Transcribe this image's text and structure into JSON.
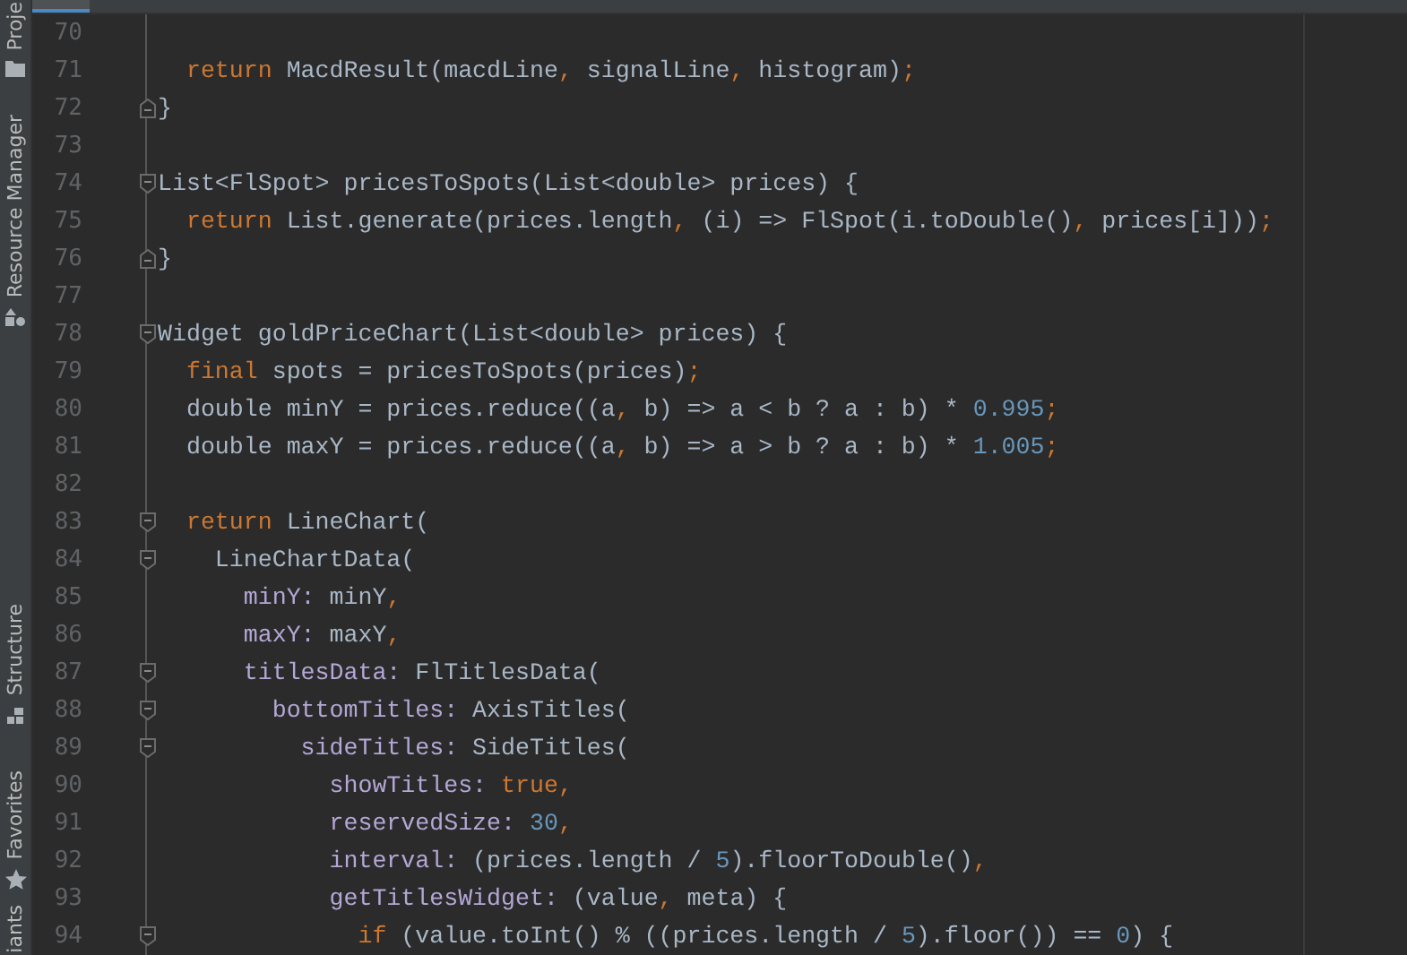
{
  "sidebar": {
    "tool_windows": [
      {
        "label": "Proje"
      },
      {
        "label": "Resource Manager"
      },
      {
        "label": "Structure"
      },
      {
        "label": "Favorites"
      },
      {
        "label": "iants"
      }
    ]
  },
  "editor": {
    "lines": [
      {
        "number": "70",
        "kind": "plain"
      },
      {
        "number": "71",
        "kind": "plain",
        "tokens": [
          {
            "kind": "keyword",
            "text": "  return"
          },
          {
            "kind": "plain",
            "text": " MacdResult(macdLine"
          },
          {
            "kind": "punct",
            "text": ","
          },
          {
            "kind": "plain",
            "text": " signalLine"
          },
          {
            "kind": "punct",
            "text": ","
          },
          {
            "kind": "plain",
            "text": " histogram)"
          },
          {
            "kind": "punct",
            "text": ";"
          }
        ]
      },
      {
        "number": "72",
        "kind": "closer",
        "tokens": [
          {
            "kind": "plain",
            "text": "}"
          }
        ]
      },
      {
        "number": "73",
        "kind": "plain"
      },
      {
        "number": "74",
        "kind": "opener",
        "tokens": [
          {
            "kind": "plain",
            "text": "List<FlSpot> pricesToSpots(List<double> prices) {"
          }
        ]
      },
      {
        "number": "75",
        "kind": "plain",
        "tokens": [
          {
            "kind": "keyword",
            "text": "  return"
          },
          {
            "kind": "plain",
            "text": " List.generate(prices.length"
          },
          {
            "kind": "punct",
            "text": ","
          },
          {
            "kind": "plain",
            "text": " (i) => FlSpot(i.toDouble()"
          },
          {
            "kind": "punct",
            "text": ","
          },
          {
            "kind": "plain",
            "text": " prices[i]))"
          },
          {
            "kind": "punct",
            "text": ";"
          }
        ]
      },
      {
        "number": "76",
        "kind": "closer",
        "tokens": [
          {
            "kind": "plain",
            "text": "}"
          }
        ]
      },
      {
        "number": "77",
        "kind": "plain"
      },
      {
        "number": "78",
        "kind": "opener",
        "tokens": [
          {
            "kind": "plain",
            "text": "Widget goldPriceChart(List<double> prices) {"
          }
        ]
      },
      {
        "number": "79",
        "kind": "plain",
        "tokens": [
          {
            "kind": "keyword",
            "text": "  final"
          },
          {
            "kind": "plain",
            "text": " spots = pricesToSpots(prices)"
          },
          {
            "kind": "punct",
            "text": ";"
          }
        ]
      },
      {
        "number": "80",
        "kind": "plain",
        "tokens": [
          {
            "kind": "plain",
            "text": "  double minY = prices.reduce((a"
          },
          {
            "kind": "punct",
            "text": ","
          },
          {
            "kind": "plain",
            "text": " b) => a < b ? a : b) * "
          },
          {
            "kind": "number",
            "text": "0.995"
          },
          {
            "kind": "punct",
            "text": ";"
          }
        ]
      },
      {
        "number": "81",
        "kind": "plain",
        "tokens": [
          {
            "kind": "plain",
            "text": "  double maxY = prices.reduce((a"
          },
          {
            "kind": "punct",
            "text": ","
          },
          {
            "kind": "plain",
            "text": " b) => a > b ? a : b) * "
          },
          {
            "kind": "number",
            "text": "1.005"
          },
          {
            "kind": "punct",
            "text": ";"
          }
        ]
      },
      {
        "number": "82",
        "kind": "plain"
      },
      {
        "number": "83",
        "kind": "opener",
        "tokens": [
          {
            "kind": "keyword",
            "text": "  return"
          },
          {
            "kind": "plain",
            "text": " LineChart("
          }
        ]
      },
      {
        "number": "84",
        "kind": "opener",
        "tokens": [
          {
            "kind": "plain",
            "text": "    LineChartData("
          }
        ]
      },
      {
        "number": "85",
        "kind": "plain",
        "tokens": [
          {
            "kind": "label",
            "text": "      minY:"
          },
          {
            "kind": "plain",
            "text": " minY"
          },
          {
            "kind": "punct",
            "text": ","
          }
        ]
      },
      {
        "number": "86",
        "kind": "plain",
        "tokens": [
          {
            "kind": "label",
            "text": "      maxY:"
          },
          {
            "kind": "plain",
            "text": " maxY"
          },
          {
            "kind": "punct",
            "text": ","
          }
        ]
      },
      {
        "number": "87",
        "kind": "opener",
        "tokens": [
          {
            "kind": "label",
            "text": "      titlesData:"
          },
          {
            "kind": "plain",
            "text": " FlTitlesData("
          }
        ]
      },
      {
        "number": "88",
        "kind": "opener",
        "tokens": [
          {
            "kind": "label",
            "text": "        bottomTitles:"
          },
          {
            "kind": "plain",
            "text": " AxisTitles("
          }
        ]
      },
      {
        "number": "89",
        "kind": "opener",
        "tokens": [
          {
            "kind": "label",
            "text": "          sideTitles:"
          },
          {
            "kind": "plain",
            "text": " SideTitles("
          }
        ]
      },
      {
        "number": "90",
        "kind": "plain",
        "tokens": [
          {
            "kind": "label",
            "text": "            showTitles:"
          },
          {
            "kind": "keyword",
            "text": " true"
          },
          {
            "kind": "punct",
            "text": ","
          }
        ]
      },
      {
        "number": "91",
        "kind": "plain",
        "tokens": [
          {
            "kind": "label",
            "text": "            reservedSize:"
          },
          {
            "kind": "number",
            "text": " 30"
          },
          {
            "kind": "punct",
            "text": ","
          }
        ]
      },
      {
        "number": "92",
        "kind": "plain",
        "tokens": [
          {
            "kind": "label",
            "text": "            interval:"
          },
          {
            "kind": "plain",
            "text": " (prices.length / "
          },
          {
            "kind": "number",
            "text": "5"
          },
          {
            "kind": "plain",
            "text": ").floorToDouble()"
          },
          {
            "kind": "punct",
            "text": ","
          }
        ]
      },
      {
        "number": "93",
        "kind": "plain",
        "tokens": [
          {
            "kind": "label",
            "text": "            getTitlesWidget:"
          },
          {
            "kind": "plain",
            "text": " (value"
          },
          {
            "kind": "punct",
            "text": ","
          },
          {
            "kind": "plain",
            "text": " meta) {"
          }
        ]
      },
      {
        "number": "94",
        "kind": "opener",
        "tokens": [
          {
            "kind": "keyword",
            "text": "              if"
          },
          {
            "kind": "plain",
            "text": " (value.toInt() % ((prices.length / "
          },
          {
            "kind": "number",
            "text": "5"
          },
          {
            "kind": "plain",
            "text": ").floor()) == "
          },
          {
            "kind": "number",
            "text": "0"
          },
          {
            "kind": "plain",
            "text": ") {"
          }
        ]
      }
    ]
  }
}
